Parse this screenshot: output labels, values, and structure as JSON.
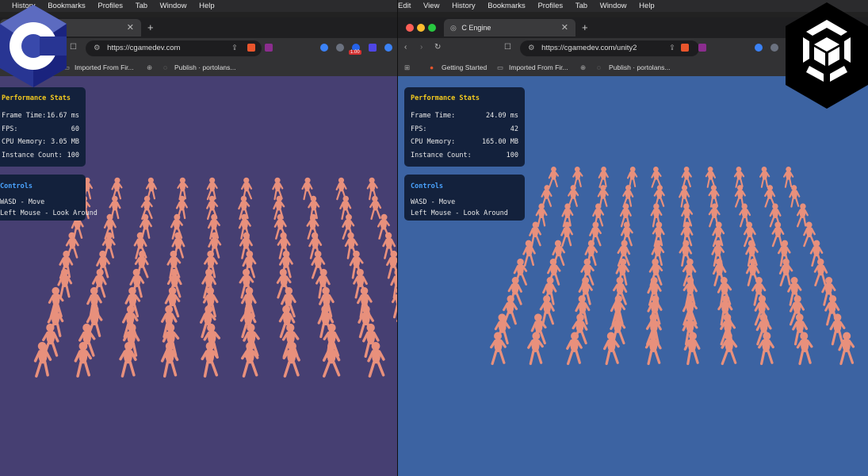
{
  "left": {
    "menu": [
      "History",
      "Bookmarks",
      "Profiles",
      "Tab",
      "Window",
      "Help"
    ],
    "url": "https://cgamedev.com",
    "bookmarks": [
      "Imported From Fir...",
      "Publish · portolans..."
    ],
    "badge": "1.00",
    "stats": {
      "title": "Performance Stats",
      "frame_time_label": "Frame Time:",
      "frame_time": "16.67 ms",
      "fps_label": "FPS:",
      "fps": "60",
      "memory_label": "CPU Memory:",
      "memory": "3.05 MB",
      "instance_label": "Instance Count:",
      "instance": "100"
    },
    "controls": {
      "title": "Controls",
      "move": "WASD - Move",
      "look": "Left Mouse - Look Around"
    },
    "colors": {
      "background": "#463f72",
      "figure": "#e8907c"
    }
  },
  "right": {
    "menu": [
      "Edit",
      "View",
      "History",
      "Bookmarks",
      "Profiles",
      "Tab",
      "Window",
      "Help"
    ],
    "tab_title": "C Engine",
    "url": "https://cgamedev.com/unity2",
    "bookmarks": [
      "Getting Started",
      "Imported From Fir...",
      "Publish · portolans..."
    ],
    "stats": {
      "title": "Performance Stats",
      "frame_time_label": "Frame Time:",
      "frame_time": "24.09 ms",
      "fps_label": "FPS:",
      "fps": "42",
      "memory_label": "CPU Memory:",
      "memory": "165.00 MB",
      "instance_label": "Instance Count:",
      "instance": "100"
    },
    "controls": {
      "title": "Controls",
      "move": "WASD - Move",
      "look": "Left Mouse - Look Around"
    },
    "colors": {
      "background": "#3c63a2",
      "figure": "#e8907c"
    }
  },
  "logos": {
    "left": "c-language-logo",
    "right": "unity-logo"
  }
}
